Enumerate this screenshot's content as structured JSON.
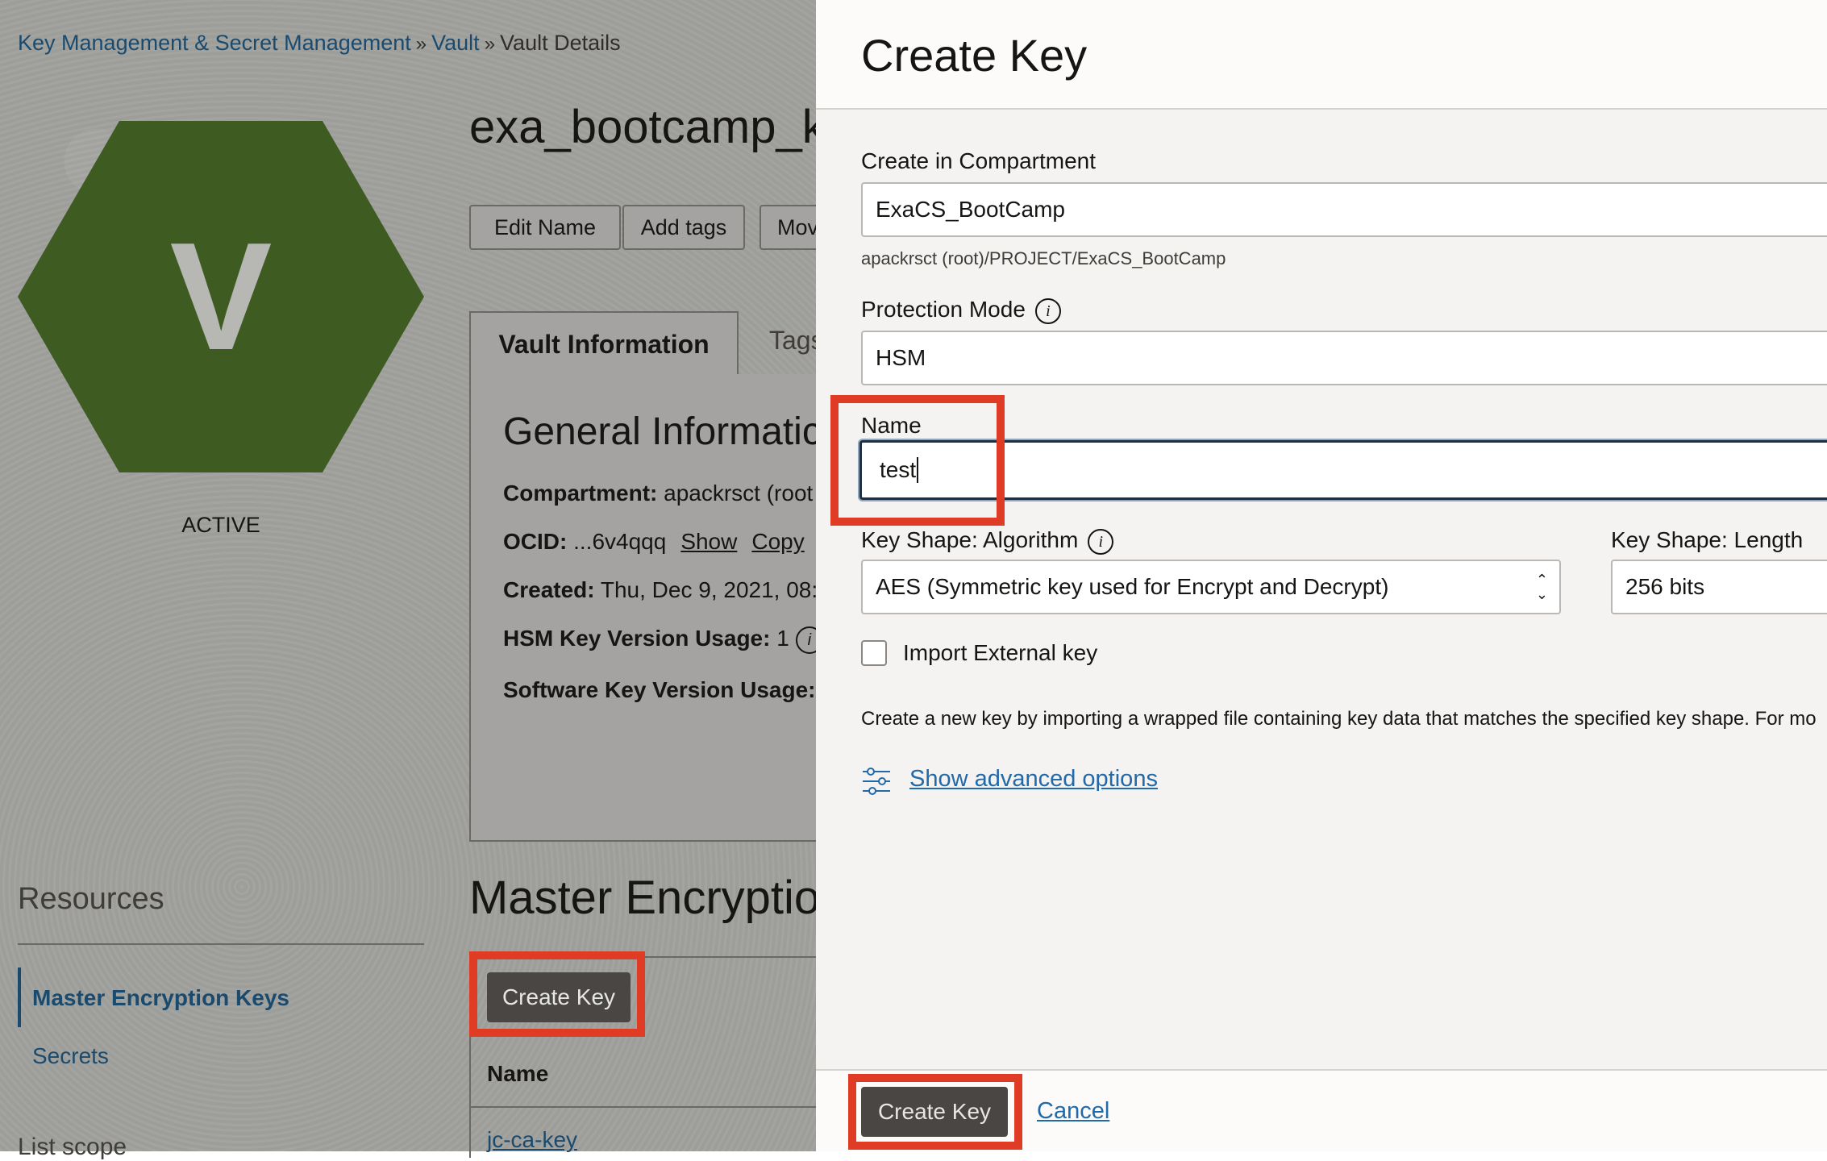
{
  "breadcrumb": {
    "items": [
      "Key Management & Secret Management",
      "Vault"
    ],
    "current": "Vault Details",
    "separator": "»"
  },
  "vault": {
    "avatar_letter": "V",
    "status": "ACTIVE",
    "name": "exa_bootcamp_k",
    "actions": [
      "Edit Name",
      "Add tags",
      "Mov"
    ],
    "tabs": [
      "Vault Information",
      "Tags"
    ],
    "info": {
      "heading": "General Informatic",
      "compartment_label": "Compartment:",
      "compartment_value": "apackrsct (root",
      "ocid_label": "OCID:",
      "ocid_value": "...6v4qqq",
      "show_link": "Show",
      "copy_link": "Copy",
      "created_label": "Created:",
      "created_value": "Thu, Dec 9, 2021, 08:",
      "hsm_label": "HSM Key Version Usage:",
      "hsm_value": "1",
      "software_label": "Software Key Version Usage:"
    }
  },
  "resources": {
    "heading": "Resources",
    "items": [
      "Master Encryption Keys",
      "Secrets"
    ],
    "list_scope": "List scope"
  },
  "keys_section": {
    "title": "Master Encryptio",
    "create_button": "Create Key",
    "column_name": "Name",
    "first_key": "jc-ca-key"
  },
  "panel": {
    "title": "Create Key",
    "compartment_label": "Create in Compartment",
    "compartment_value": "ExaCS_BootCamp",
    "compartment_path": "apackrsct (root)/PROJECT/ExaCS_BootCamp",
    "protection_label": "Protection Mode",
    "protection_value": "HSM",
    "name_label": "Name",
    "name_value": "test",
    "algorithm_label": "Key Shape: Algorithm",
    "algorithm_value": "AES (Symmetric key used for Encrypt and Decrypt)",
    "length_label": "Key Shape: Length",
    "length_value": "256 bits",
    "import_label": "Import External key",
    "import_checked": false,
    "description": "Create a new key by importing a wrapped file containing key data that matches the specified key shape. For mo",
    "advanced_link": "Show advanced options",
    "submit": "Create Key",
    "cancel": "Cancel"
  },
  "colors": {
    "highlight": "#e03b24",
    "link": "#2169a8",
    "avatar": "#3e5c22",
    "primary_button": "#4a4643"
  }
}
